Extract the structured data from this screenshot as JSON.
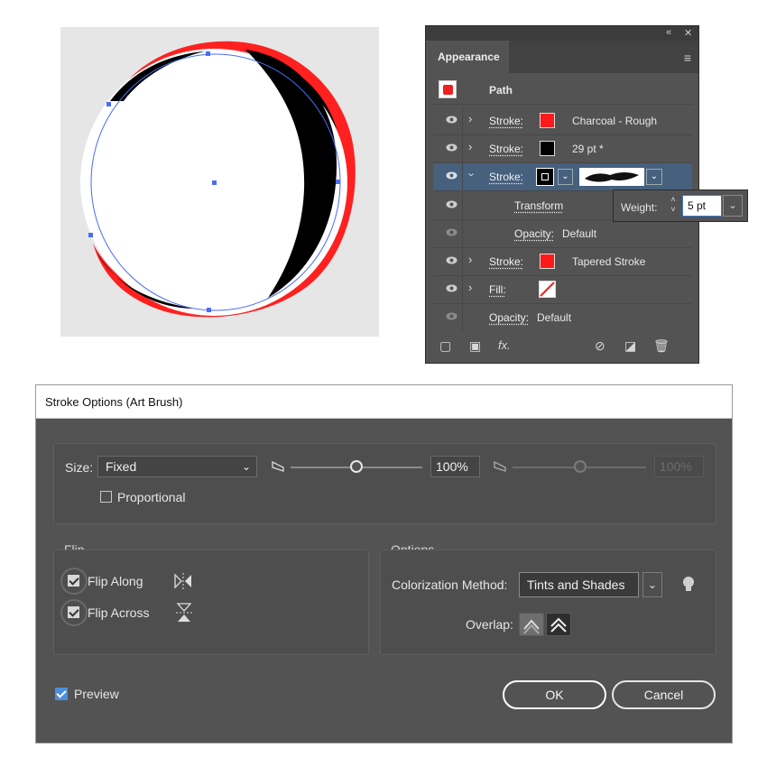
{
  "appearance_panel": {
    "collapse_icon": "double-chevron-left-icon",
    "close_icon": "close-icon",
    "tab_label": "Appearance",
    "menu_icon": "hamburger-menu-icon",
    "header_label": "Path",
    "rows": [
      {
        "label": "Stroke:",
        "value": "Charcoal - Rough",
        "swatch_color": "#ff1a1a"
      },
      {
        "label": "Stroke:",
        "value": "29 pt *",
        "swatch_color": "#000000"
      },
      {
        "label": "Stroke:",
        "value": "",
        "swatch_color": "#000000"
      },
      {
        "label": "Transform",
        "value": ""
      },
      {
        "label": "Opacity:",
        "value": "Default"
      },
      {
        "label": "Stroke:",
        "value": "Tapered Stroke",
        "swatch_color": "#ff1a1a"
      },
      {
        "label": "Fill:",
        "value": "",
        "swatch_color": "#ffffff"
      },
      {
        "label": "Opacity:",
        "value": "Default"
      }
    ],
    "weight_popup": {
      "label": "Weight:",
      "value": "5 pt"
    }
  },
  "dialog": {
    "title": "Stroke Options (Art Brush)",
    "size_label": "Size:",
    "size_value": "Fixed",
    "size_percent": "100%",
    "size_percent_disabled": "100%",
    "proportional_label": "Proportional",
    "proportional_checked": false,
    "flip_title": "Flip",
    "flip_along_label": "Flip Along",
    "flip_along_checked": true,
    "flip_across_label": "Flip Across",
    "flip_across_checked": true,
    "options_title": "Options",
    "colorization_label": "Colorization Method:",
    "colorization_value": "Tints and Shades",
    "overlap_label": "Overlap:",
    "preview_label": "Preview",
    "preview_checked": true,
    "ok_label": "OK",
    "cancel_label": "Cancel"
  },
  "colors": {
    "panel_bg": "#535353",
    "highlight_row": "#46607e",
    "stroke_red": "#ff1a1a",
    "checkbox_blue": "#4b8fdc",
    "selection_blue": "#4a6cf7"
  }
}
